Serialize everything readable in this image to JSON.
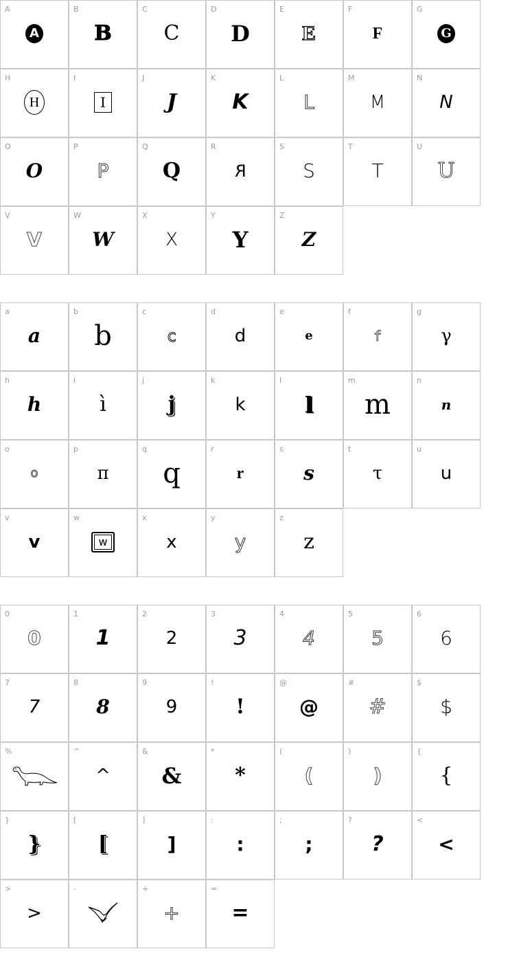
{
  "sections": [
    {
      "name": "uppercase",
      "cells": [
        {
          "label": "A",
          "glyph": "A",
          "style": "circle-letter"
        },
        {
          "label": "B",
          "glyph": "B",
          "style": "serif-bold-outline"
        },
        {
          "label": "C",
          "glyph": "C",
          "style": "serif"
        },
        {
          "label": "D",
          "glyph": "D",
          "style": "serif-black"
        },
        {
          "label": "E",
          "glyph": "E",
          "style": "engraved"
        },
        {
          "label": "F",
          "glyph": "F",
          "style": "blackletter"
        },
        {
          "label": "G",
          "glyph": "G",
          "style": "black-oval"
        },
        {
          "label": "H",
          "glyph": "H",
          "style": "ornate-oval"
        },
        {
          "label": "I",
          "glyph": "I",
          "style": "framed"
        },
        {
          "label": "J",
          "glyph": "J",
          "style": "serif-italic"
        },
        {
          "label": "K",
          "glyph": "K",
          "style": "heavy-italic"
        },
        {
          "label": "L",
          "glyph": "L",
          "style": "outline"
        },
        {
          "label": "M",
          "glyph": "M",
          "style": "thin-sans"
        },
        {
          "label": "N",
          "glyph": "N",
          "style": "thin-italic"
        },
        {
          "label": "O",
          "glyph": "O",
          "style": "script"
        },
        {
          "label": "P",
          "glyph": "P",
          "style": "outline"
        },
        {
          "label": "Q",
          "glyph": "Q",
          "style": "serif-bold"
        },
        {
          "label": "R",
          "glyph": "R",
          "style": "mirrored"
        },
        {
          "label": "S",
          "glyph": "S",
          "style": "angular"
        },
        {
          "label": "T",
          "glyph": "T",
          "style": "angular"
        },
        {
          "label": "U",
          "glyph": "U",
          "style": "outline-ornate"
        },
        {
          "label": "V",
          "glyph": "V",
          "style": "hatched"
        },
        {
          "label": "W",
          "glyph": "W",
          "style": "script"
        },
        {
          "label": "X",
          "glyph": "X",
          "style": "thin"
        },
        {
          "label": "Y",
          "glyph": "Y",
          "style": "serif-black"
        },
        {
          "label": "Z",
          "glyph": "Z",
          "style": "script"
        }
      ]
    },
    {
      "name": "lowercase",
      "cells": [
        {
          "label": "a",
          "glyph": "a",
          "style": "script"
        },
        {
          "label": "b",
          "glyph": "b",
          "style": "serif-large"
        },
        {
          "label": "c",
          "glyph": "c",
          "style": "outline-square"
        },
        {
          "label": "d",
          "glyph": "d",
          "style": "sans"
        },
        {
          "label": "e",
          "glyph": "e",
          "style": "small-bold"
        },
        {
          "label": "f",
          "glyph": "f",
          "style": "pixel"
        },
        {
          "label": "g",
          "glyph": "γ",
          "style": "greek"
        },
        {
          "label": "h",
          "glyph": "h",
          "style": "script"
        },
        {
          "label": "i",
          "glyph": "ì",
          "style": "serif"
        },
        {
          "label": "j",
          "glyph": "j",
          "style": "shadow"
        },
        {
          "label": "k",
          "glyph": "k",
          "style": "sans"
        },
        {
          "label": "l",
          "glyph": "l",
          "style": "shadow-serif"
        },
        {
          "label": "m",
          "glyph": "m",
          "style": "serif-large"
        },
        {
          "label": "n",
          "glyph": "n",
          "style": "script-small"
        },
        {
          "label": "o",
          "glyph": "o",
          "style": "outline-small"
        },
        {
          "label": "p",
          "glyph": "π",
          "style": "greek"
        },
        {
          "label": "q",
          "glyph": "q",
          "style": "serif-large"
        },
        {
          "label": "r",
          "glyph": "r",
          "style": "blackletter"
        },
        {
          "label": "s",
          "glyph": "s",
          "style": "script"
        },
        {
          "label": "t",
          "glyph": "τ",
          "style": "greek"
        },
        {
          "label": "u",
          "glyph": "u",
          "style": "sans"
        },
        {
          "label": "v",
          "glyph": "v",
          "style": "heavy-script"
        },
        {
          "label": "w",
          "glyph": "w",
          "style": "keycap"
        },
        {
          "label": "x",
          "glyph": "x",
          "style": "sans"
        },
        {
          "label": "y",
          "glyph": "y",
          "style": "outline"
        },
        {
          "label": "z",
          "glyph": "z",
          "style": "serif"
        }
      ]
    },
    {
      "name": "numbers-symbols",
      "cells": [
        {
          "label": "0",
          "glyph": "0",
          "style": "hatched"
        },
        {
          "label": "1",
          "glyph": "1",
          "style": "heavy-italic"
        },
        {
          "label": "2",
          "glyph": "2",
          "style": "sans"
        },
        {
          "label": "3",
          "glyph": "3",
          "style": "italic"
        },
        {
          "label": "4",
          "glyph": "4",
          "style": "outline-italic"
        },
        {
          "label": "5",
          "glyph": "5",
          "style": "outline"
        },
        {
          "label": "6",
          "glyph": "6",
          "style": "angular"
        },
        {
          "label": "7",
          "glyph": "7",
          "style": "thin-italic"
        },
        {
          "label": "8",
          "glyph": "8",
          "style": "script"
        },
        {
          "label": "9",
          "glyph": "9",
          "style": "sans"
        },
        {
          "label": "!",
          "glyph": "!",
          "style": "serif-bold"
        },
        {
          "label": "@",
          "glyph": "@",
          "style": "heavy"
        },
        {
          "label": "#",
          "glyph": "#",
          "style": "outline-ornate"
        },
        {
          "label": "$",
          "glyph": "$",
          "style": "angular"
        },
        {
          "label": "%",
          "glyph": "",
          "style": "dinosaur-icon"
        },
        {
          "label": "^",
          "glyph": "^",
          "style": "sans"
        },
        {
          "label": "&",
          "glyph": "&",
          "style": "serif-black"
        },
        {
          "label": "*",
          "glyph": "*",
          "style": "serif-bold"
        },
        {
          "label": "(",
          "glyph": "(",
          "style": "hatched"
        },
        {
          "label": ")",
          "glyph": ")",
          "style": "hatched"
        },
        {
          "label": "{",
          "glyph": "{",
          "style": "serif"
        },
        {
          "label": "}",
          "glyph": "}",
          "style": "shadow"
        },
        {
          "label": "[",
          "glyph": "[",
          "style": "shadow"
        },
        {
          "label": "]",
          "glyph": "]",
          "style": "heavy"
        },
        {
          "label": ":",
          "glyph": ":",
          "style": "heavy"
        },
        {
          "label": ";",
          "glyph": ";",
          "style": "heavy"
        },
        {
          "label": "?",
          "glyph": "?",
          "style": "heavy-italic"
        },
        {
          "label": "<",
          "glyph": "<",
          "style": "heavy"
        },
        {
          "label": ">",
          "glyph": ">",
          "style": "sans"
        },
        {
          "label": "-",
          "glyph": "",
          "style": "pterodactyl-icon"
        },
        {
          "label": "+",
          "glyph": "+",
          "style": "outline"
        },
        {
          "label": "=",
          "glyph": "=",
          "style": "heavy-italic"
        }
      ]
    }
  ]
}
